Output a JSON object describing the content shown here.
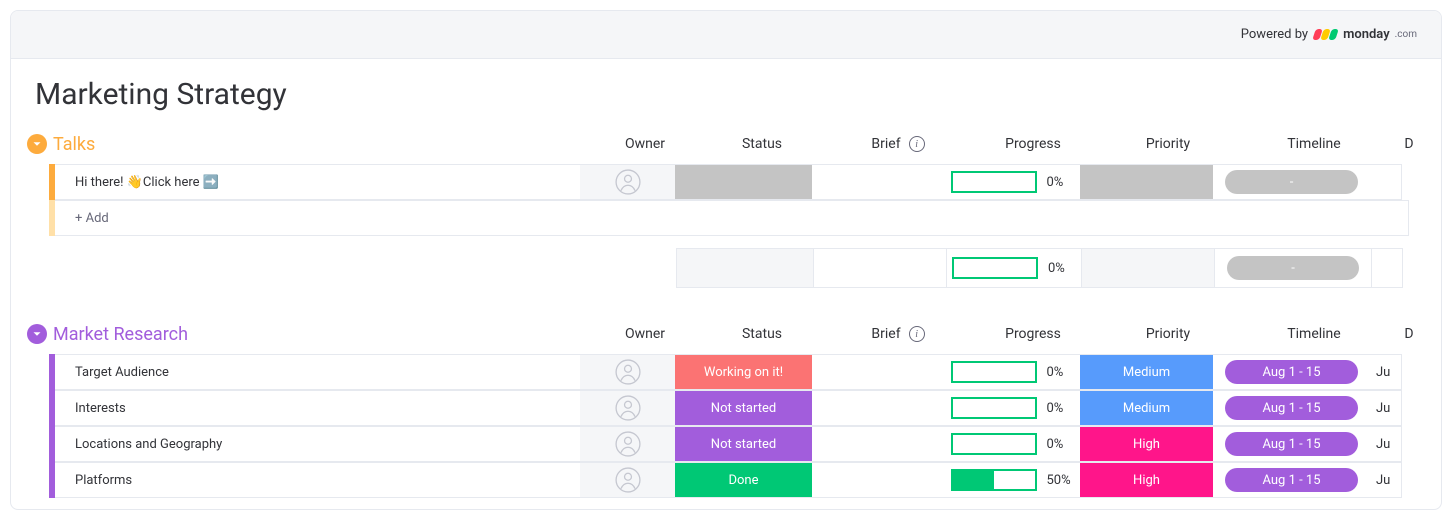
{
  "powered_by_label": "Powered by",
  "brand_name": "monday",
  "brand_suffix": ".com",
  "board_title": "Marketing Strategy",
  "columns": {
    "owner": "Owner",
    "status": "Status",
    "brief": "Brief",
    "progress": "Progress",
    "priority": "Priority",
    "timeline": "Timeline",
    "extra": "D"
  },
  "add_item_label": "+ Add",
  "groups": [
    {
      "id": "talks",
      "name": "Talks",
      "color": "#fdab3d",
      "color_light": "#ffe0a8",
      "items": [
        {
          "name": "Hi there! 👋Click here ➡️",
          "status": {
            "label": "",
            "color": "#c4c4c4"
          },
          "progress": {
            "pct": 0,
            "label": "0%"
          },
          "priority": {
            "label": "",
            "color": "#c4c4c4"
          },
          "timeline": {
            "label": "-",
            "color": "#c4c4c4"
          },
          "extra": ""
        }
      ],
      "summary": {
        "progress": {
          "pct": 0,
          "label": "0%"
        },
        "timeline": {
          "label": "-",
          "color": "#c4c4c4"
        }
      }
    },
    {
      "id": "market-research",
      "name": "Market Research",
      "color": "#a25ddc",
      "color_light": "#d8c2ef",
      "items": [
        {
          "name": "Target Audience",
          "status": {
            "label": "Working on it!",
            "color": "#fb7373"
          },
          "progress": {
            "pct": 0,
            "label": "0%"
          },
          "priority": {
            "label": "Medium",
            "color": "#579bfc"
          },
          "timeline": {
            "label": "Aug 1 - 15",
            "color": "#a25ddc"
          },
          "extra": "Ju"
        },
        {
          "name": "Interests",
          "status": {
            "label": "Not started",
            "color": "#a25ddc"
          },
          "progress": {
            "pct": 0,
            "label": "0%"
          },
          "priority": {
            "label": "Medium",
            "color": "#579bfc"
          },
          "timeline": {
            "label": "Aug 1 - 15",
            "color": "#a25ddc"
          },
          "extra": "Ju"
        },
        {
          "name": "Locations and Geography",
          "status": {
            "label": "Not started",
            "color": "#a25ddc"
          },
          "progress": {
            "pct": 0,
            "label": "0%"
          },
          "priority": {
            "label": "High",
            "color": "#ff158a"
          },
          "timeline": {
            "label": "Aug 1 - 15",
            "color": "#a25ddc"
          },
          "extra": "Ju"
        },
        {
          "name": "Platforms",
          "status": {
            "label": "Done",
            "color": "#00c875"
          },
          "progress": {
            "pct": 50,
            "label": "50%"
          },
          "priority": {
            "label": "High",
            "color": "#ff158a"
          },
          "timeline": {
            "label": "Aug 1 - 15",
            "color": "#a25ddc"
          },
          "extra": "Ju"
        }
      ]
    }
  ]
}
